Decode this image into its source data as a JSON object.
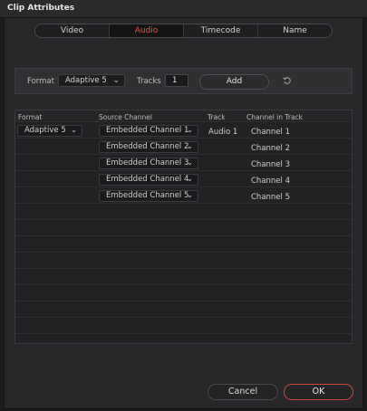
{
  "window": {
    "title": "Clip Attributes"
  },
  "tabs": [
    {
      "label": "Video",
      "active": false
    },
    {
      "label": "Audio",
      "active": true
    },
    {
      "label": "Timecode",
      "active": false
    },
    {
      "label": "Name",
      "active": false
    }
  ],
  "format_bar": {
    "format_label": "Format",
    "format_value": "Adaptive 5",
    "tracks_label": "Tracks",
    "tracks_value": "1",
    "add_label": "Add",
    "reset_icon": "reset-arrow-icon"
  },
  "table": {
    "headers": [
      "Format",
      "Source Channel",
      "Track",
      "Channel in Track"
    ],
    "format_value": "Adaptive 5",
    "track_value": "Audio 1",
    "rows": [
      {
        "source": "Embedded Channel 1",
        "channel": "Channel 1"
      },
      {
        "source": "Embedded Channel 2",
        "channel": "Channel 2"
      },
      {
        "source": "Embedded Channel 3",
        "channel": "Channel 3"
      },
      {
        "source": "Embedded Channel 4",
        "channel": "Channel 4"
      },
      {
        "source": "Embedded Channel 5",
        "channel": "Channel 5"
      }
    ]
  },
  "footer": {
    "cancel_label": "Cancel",
    "ok_label": "OK"
  },
  "colors": {
    "accent": "#e5553f",
    "ok_border": "#c94638",
    "background": "#28282b"
  }
}
